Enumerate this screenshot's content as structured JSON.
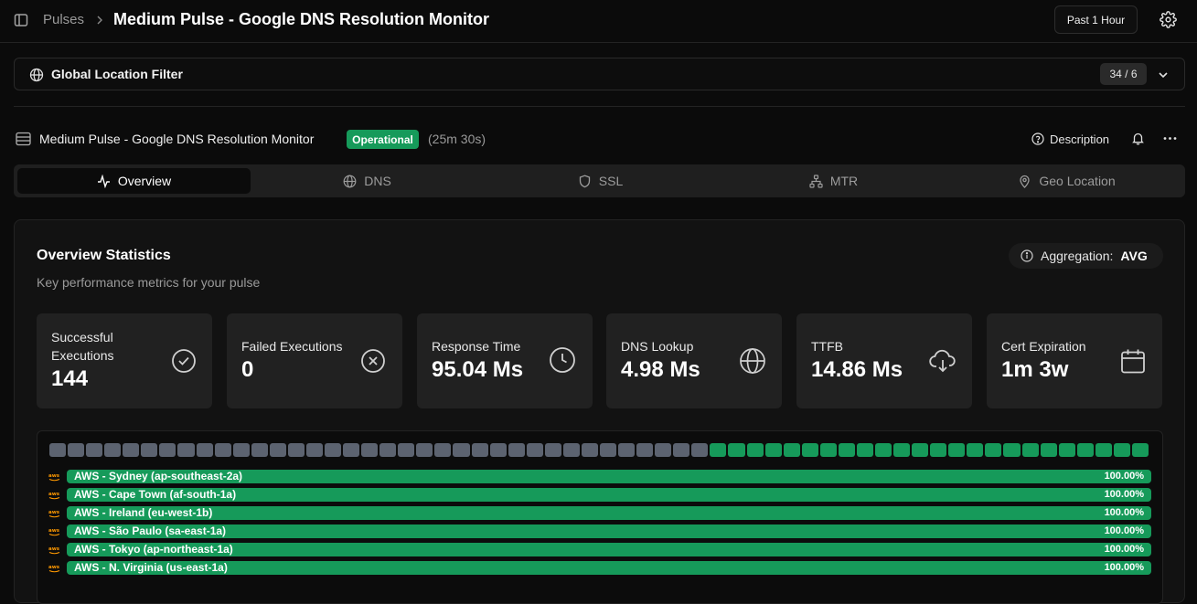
{
  "header": {
    "breadcrumb": "Pulses",
    "title": "Medium Pulse - Google DNS Resolution Monitor",
    "time_range": "Past 1 Hour"
  },
  "filter": {
    "label": "Global Location Filter",
    "count": "34 / 6"
  },
  "pulse": {
    "name": "Medium Pulse - Google DNS Resolution Monitor",
    "status": "Operational",
    "uptime": "(25m 30s)",
    "description_label": "Description"
  },
  "tabs": [
    {
      "label": "Overview",
      "icon": "activity-icon",
      "active": true
    },
    {
      "label": "DNS",
      "icon": "globe-icon",
      "active": false
    },
    {
      "label": "SSL",
      "icon": "shield-icon",
      "active": false
    },
    {
      "label": "MTR",
      "icon": "network-icon",
      "active": false
    },
    {
      "label": "Geo Location",
      "icon": "map-pin-icon",
      "active": false
    }
  ],
  "overview": {
    "title": "Overview Statistics",
    "subtitle": "Key performance metrics for your pulse",
    "aggregation_label": "Aggregation:",
    "aggregation_value": "AVG"
  },
  "stats": [
    {
      "label": "Successful Executions",
      "value": "144",
      "icon": "check-circle-icon"
    },
    {
      "label": "Failed Executions",
      "value": "0",
      "icon": "x-circle-icon"
    },
    {
      "label": "Response Time",
      "value": "95.04 Ms",
      "icon": "clock-icon"
    },
    {
      "label": "DNS Lookup",
      "value": "4.98 Ms",
      "icon": "globe-icon"
    },
    {
      "label": "TTFB",
      "value": "14.86 Ms",
      "icon": "cloud-download-icon"
    },
    {
      "label": "Cert Expiration",
      "value": "1m 3w",
      "icon": "calendar-icon"
    }
  ],
  "timeline": {
    "total_blocks": 60,
    "no_data_blocks": 36,
    "colors": {
      "no_data": "#5c6370",
      "up": "#169a5a"
    }
  },
  "locations": [
    {
      "name": "AWS - Sydney (ap-southeast-2a)",
      "percent": "100.00%"
    },
    {
      "name": "AWS - Cape Town (af-south-1a)",
      "percent": "100.00%"
    },
    {
      "name": "AWS - Ireland (eu-west-1b)",
      "percent": "100.00%"
    },
    {
      "name": "AWS - São Paulo (sa-east-1a)",
      "percent": "100.00%"
    },
    {
      "name": "AWS - Tokyo (ap-northeast-1a)",
      "percent": "100.00%"
    },
    {
      "name": "AWS - N. Virginia (us-east-1a)",
      "percent": "100.00%"
    }
  ]
}
